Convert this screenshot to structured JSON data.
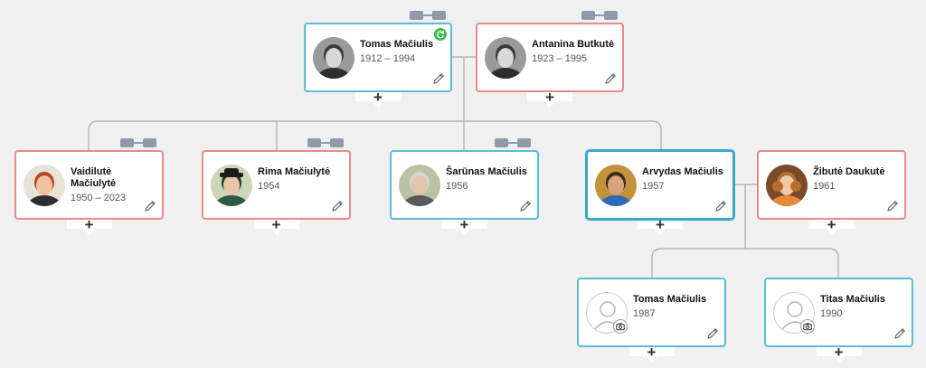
{
  "colors": {
    "male_border": "#5bbcd6",
    "female_border": "#e88a8a",
    "connector": "#a9a9a9",
    "background": "#f0f0f0",
    "sync_badge": "#3fb950"
  },
  "add_label": "+",
  "people": [
    {
      "id": "tomas_sr",
      "name": "Tomas Mačiulis",
      "years": "1912 – 1994",
      "gender": "male",
      "photo": "bw-portrait",
      "sync": true
    },
    {
      "id": "antanina",
      "name": "Antanina Butkutė",
      "years": "1923 – 1995",
      "gender": "female",
      "photo": "bw-portrait"
    },
    {
      "id": "vaidilute",
      "name": "Vaidilutė Mačiulytė",
      "years": "1950 – 2023",
      "gender": "female",
      "photo": "portrait-redhair"
    },
    {
      "id": "rima",
      "name": "Rima Mačiulytė",
      "years": "1954",
      "gender": "female",
      "photo": "portrait-hat"
    },
    {
      "id": "sarunas",
      "name": "Šarūnas Mačiulis",
      "years": "1956",
      "gender": "male",
      "photo": "portrait-grey"
    },
    {
      "id": "arvydas",
      "name": "Arvydas Mačiulis",
      "years": "1957",
      "gender": "male",
      "photo": "portrait-blue",
      "selected": true
    },
    {
      "id": "zibute",
      "name": "Žibutė Daukutė",
      "years": "1961",
      "gender": "female",
      "photo": "portrait-curly"
    },
    {
      "id": "tomas_jr",
      "name": "Tomas Mačiulis",
      "years": "1987",
      "gender": "male",
      "photo": "placeholder-with-camera"
    },
    {
      "id": "titas",
      "name": "Titas Mačiulis",
      "years": "1990",
      "gender": "male",
      "photo": "placeholder-with-camera"
    }
  ],
  "icons": {
    "edit": "pencil-icon",
    "add": "plus-icon",
    "partner_link": "link-icon",
    "sync": "sync-icon",
    "upload": "camera-icon"
  }
}
